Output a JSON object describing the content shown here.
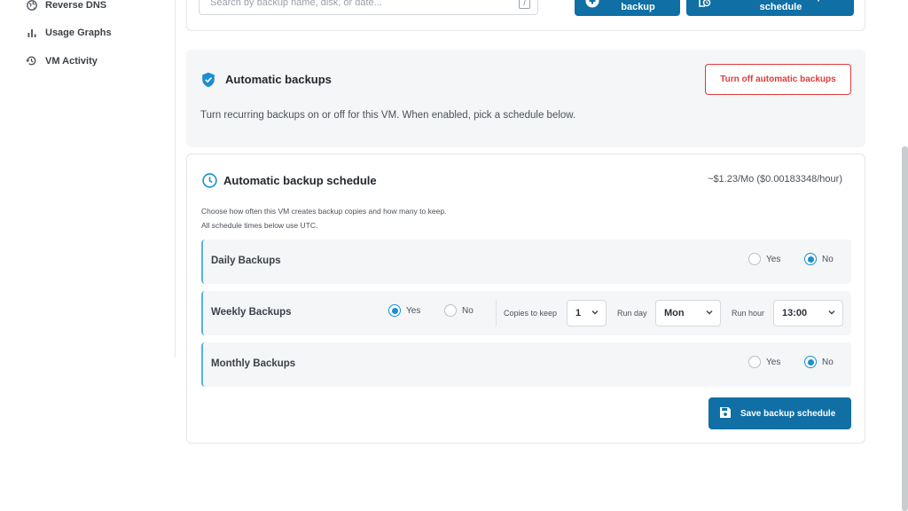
{
  "sidebar": {
    "items": [
      {
        "label": "Reverse DNS",
        "icon": "globe-icon"
      },
      {
        "label": "Usage Graphs",
        "icon": "bar-chart-icon"
      },
      {
        "label": "VM Activity",
        "icon": "history-icon"
      }
    ]
  },
  "toolbar": {
    "search_placeholder": "Search by backup name, disk, or date...",
    "search_shortcut": "/",
    "create_label": "Create backup",
    "schedule_label": "Automatic backup schedule"
  },
  "auto_backups": {
    "title": "Automatic backups",
    "description": "Turn recurring backups on or off for this VM. When enabled, pick a schedule below.",
    "toggle_label": "Turn off automatic backups"
  },
  "schedule": {
    "title": "Automatic backup schedule",
    "price": "~$1.23/Mo ($0.00183348/hour)",
    "help_line1": "Choose how often this VM creates backup copies and how many to keep.",
    "help_line2": "All schedule times below use UTC.",
    "yes_label": "Yes",
    "no_label": "No",
    "rows": [
      {
        "label": "Daily Backups",
        "enabled": false
      },
      {
        "label": "Weekly Backups",
        "enabled": true,
        "copies_label": "Copies to keep",
        "copies": "1",
        "day_label": "Run day",
        "day": "Mon",
        "hour_label": "Run hour",
        "hour": "13:00"
      },
      {
        "label": "Monthly Backups",
        "enabled": false
      }
    ],
    "save_label": "Save backup schedule"
  },
  "colors": {
    "primary": "#106fa5",
    "danger": "#e03b3b",
    "accent": "#1a8fd1"
  }
}
